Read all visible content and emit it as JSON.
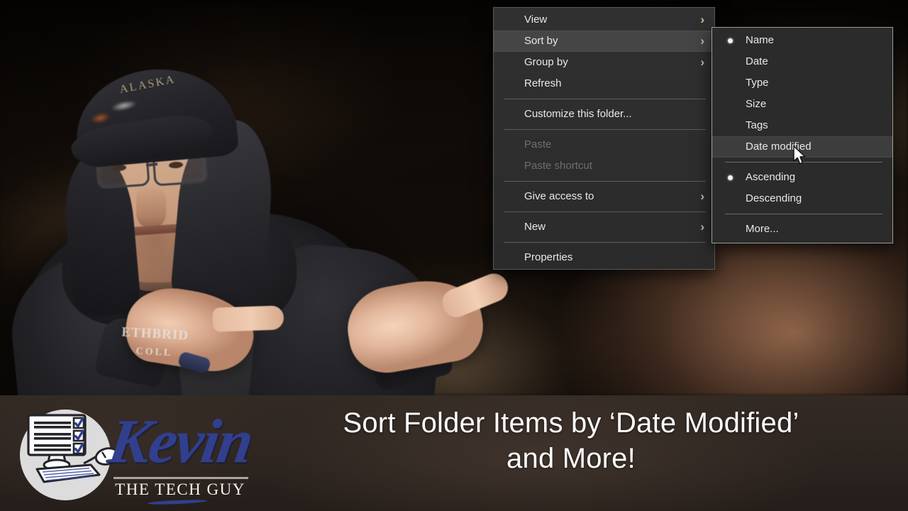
{
  "context_menu": {
    "items": [
      {
        "label": "View",
        "has_submenu": true,
        "disabled": false,
        "highlighted": false,
        "sep_after": false
      },
      {
        "label": "Sort by",
        "has_submenu": true,
        "disabled": false,
        "highlighted": true,
        "sep_after": false
      },
      {
        "label": "Group by",
        "has_submenu": true,
        "disabled": false,
        "highlighted": false,
        "sep_after": false
      },
      {
        "label": "Refresh",
        "has_submenu": false,
        "disabled": false,
        "highlighted": false,
        "sep_after": true
      },
      {
        "label": "Customize this folder...",
        "has_submenu": false,
        "disabled": false,
        "highlighted": false,
        "sep_after": true
      },
      {
        "label": "Paste",
        "has_submenu": false,
        "disabled": true,
        "highlighted": false,
        "sep_after": false
      },
      {
        "label": "Paste shortcut",
        "has_submenu": false,
        "disabled": true,
        "highlighted": false,
        "sep_after": true
      },
      {
        "label": "Give access to",
        "has_submenu": true,
        "disabled": false,
        "highlighted": false,
        "sep_after": true
      },
      {
        "label": "New",
        "has_submenu": true,
        "disabled": false,
        "highlighted": false,
        "sep_after": true
      },
      {
        "label": "Properties",
        "has_submenu": false,
        "disabled": false,
        "highlighted": false,
        "sep_after": false
      }
    ],
    "submenu_arrow": "›"
  },
  "sort_by_submenu": {
    "items": [
      {
        "label": "Name",
        "selected": true,
        "highlighted": false,
        "sep_after": false
      },
      {
        "label": "Date",
        "selected": false,
        "highlighted": false,
        "sep_after": false
      },
      {
        "label": "Type",
        "selected": false,
        "highlighted": false,
        "sep_after": false
      },
      {
        "label": "Size",
        "selected": false,
        "highlighted": false,
        "sep_after": false
      },
      {
        "label": "Tags",
        "selected": false,
        "highlighted": false,
        "sep_after": false
      },
      {
        "label": "Date modified",
        "selected": false,
        "highlighted": true,
        "sep_after": true
      },
      {
        "label": "Ascending",
        "selected": true,
        "highlighted": false,
        "sep_after": false
      },
      {
        "label": "Descending",
        "selected": false,
        "highlighted": false,
        "sep_after": true
      },
      {
        "label": "More...",
        "selected": false,
        "highlighted": false,
        "sep_after": false
      }
    ]
  },
  "banner": {
    "title_line1": "Sort Folder Items by ‘Date Modified’",
    "title_line2": "and More!",
    "logo": {
      "name": "Kevin",
      "tagline": "THE TECH GUY",
      "icon": "computer-checklist-icon"
    }
  },
  "photo": {
    "cap_text": "ALASKA",
    "shirt_line1": "ETHBRID",
    "shirt_line2": "COLL"
  },
  "colors": {
    "menu_bg": "#2b2b2b",
    "menu_highlight": "#454545",
    "submenu_highlight": "#3d3d3d",
    "menu_text": "#e8e8e8",
    "menu_disabled_text": "#6e6e6e",
    "chevron": "#d7bfa3",
    "banner_bg": "#2c2420",
    "banner_text": "#fdfdfd",
    "logo_blue": "#313f8d",
    "logo_circle": "#dcdcdc"
  }
}
